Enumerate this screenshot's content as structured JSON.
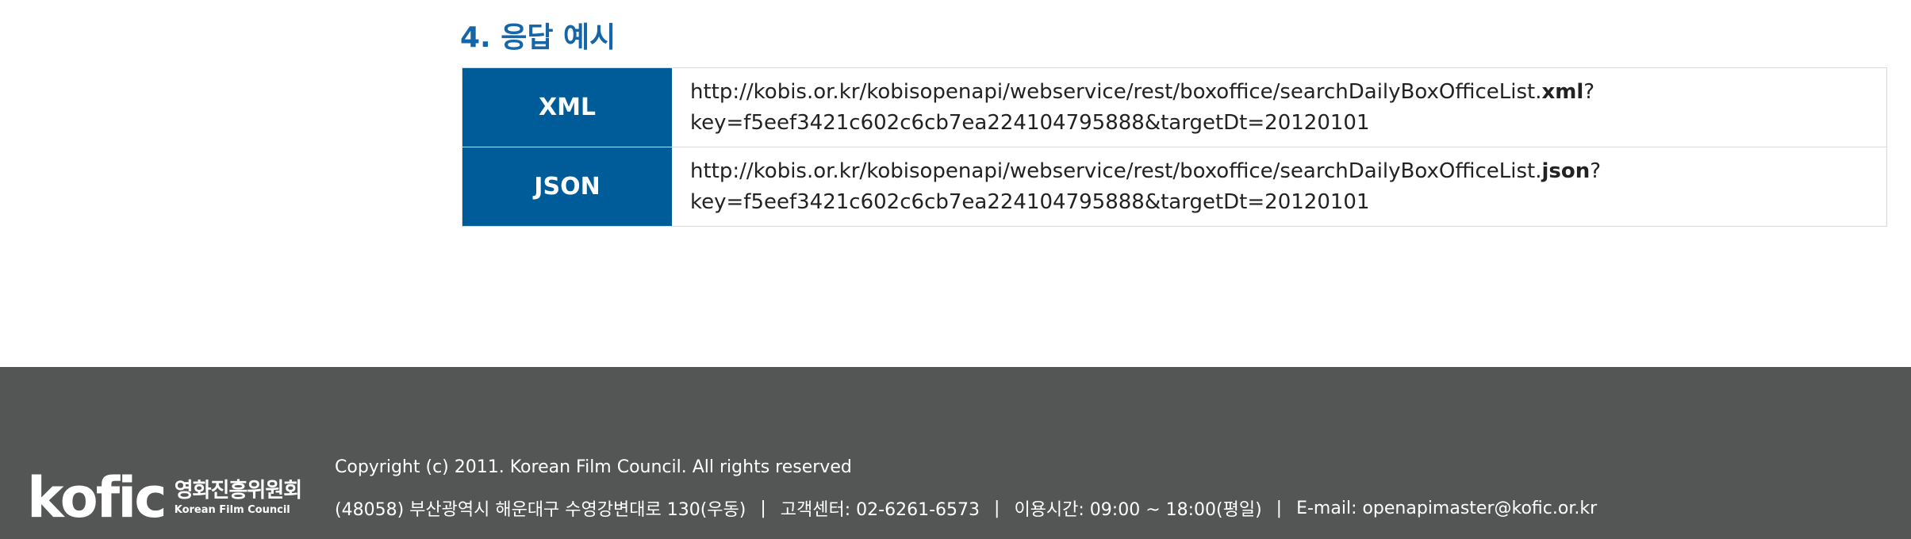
{
  "section": {
    "title": "4. 응답 예시"
  },
  "examples": [
    {
      "label": "XML",
      "url_prefix": "http://kobis.or.kr/kobisopenapi/webservice/rest/boxoffice/searchDailyBoxOfficeList.",
      "ext": "xml",
      "url_suffix": "?",
      "query": "key=f5eef3421c602c6cb7ea224104795888&targetDt=20120101"
    },
    {
      "label": "JSON",
      "url_prefix": "http://kobis.or.kr/kobisopenapi/webservice/rest/boxoffice/searchDailyBoxOfficeList.",
      "ext": "json",
      "url_suffix": "?",
      "query": "key=f5eef3421c602c6cb7ea224104795888&targetDt=20120101"
    }
  ],
  "footer": {
    "logo_word": "kofic",
    "logo_kr": "영화진흥위원회",
    "logo_en": "Korean Film Council",
    "copyright": "Copyright (c) 2011. Korean Film Council. All rights reserved",
    "address": "(48058) 부산광역시 해운대구 수영강변대로 130(우동)",
    "separator": "|",
    "call_center": "고객센터: 02-6261-6573",
    "hours": "이용시간: 09:00 ~ 18:00(평일)",
    "email": "E-mail: openapimaster@kofic.or.kr"
  },
  "colors": {
    "title": "#1565a8",
    "label_bg": "#005b99",
    "footer_bg": "#545656"
  }
}
